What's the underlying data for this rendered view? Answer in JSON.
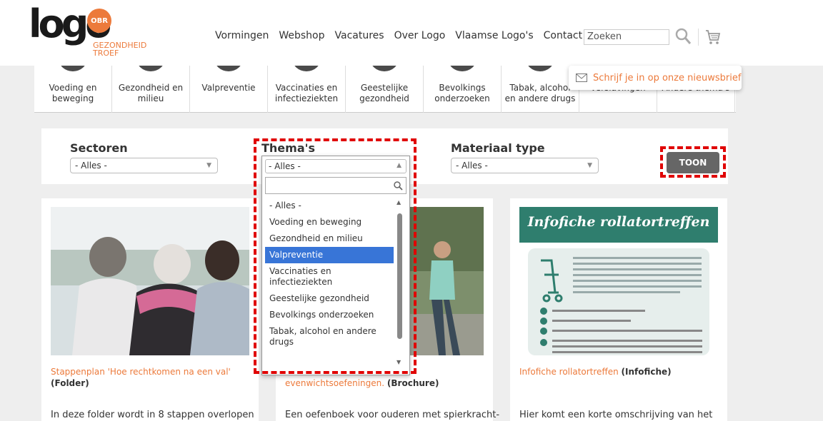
{
  "header": {
    "logo": {
      "word": "logo",
      "badge": "OBR",
      "sub1": "GEZONDHEID",
      "sub2": "TROEF"
    },
    "nav": [
      "Vormingen",
      "Webshop",
      "Vacatures",
      "Over Logo",
      "Vlaamse Logo's",
      "Contact"
    ],
    "search_placeholder": "Zoeken"
  },
  "themes": [
    "Voeding en\nbeweging",
    "Gezondheid en\nmilieu",
    "Valpreventie",
    "Vaccinaties en\ninfectieziekten",
    "Geestelijke\ngezondheid",
    "Bevolkings\nonderzoeken",
    "Tabak, alcohol\nen andere drugs",
    "Verslavingen",
    "Andere thema's"
  ],
  "newsletter": "Schrijf je in op onze nieuwsbrief",
  "filters": {
    "sectoren": {
      "label": "Sectoren",
      "value": "- Alles -"
    },
    "themas": {
      "label": "Thema's",
      "value": "- Alles -"
    },
    "materiaal": {
      "label": "Materiaal type",
      "value": "- Alles -"
    },
    "toon": "TOON"
  },
  "dropdown": {
    "options": [
      "- Alles -",
      "Voeding en beweging",
      "Gezondheid en milieu",
      "Valpreventie",
      "Vaccinaties en infectieziekten",
      "Geestelijke gezondheid",
      "Bevolkings onderzoeken",
      "Tabak, alcohol en andere drugs"
    ],
    "selected": "Valpreventie"
  },
  "cards": [
    {
      "title": "Stappenplan 'Hoe rechtkomen na een val'",
      "kind": "(Folder)",
      "desc": "In deze folder wordt in 8 stappen overlopen"
    },
    {
      "title": "evenwichtsoefeningen.",
      "kind": "(Brochure)",
      "desc": "Een oefenboek voor ouderen met spierkracht-"
    },
    {
      "title": "Infofiche rollatortreffen",
      "kind": "(Infofiche)",
      "desc": "Hier komt een korte omschrijving van het"
    }
  ],
  "infofiche_heading": "Infofiche rollatortreffen",
  "colors": {
    "accent": "#ec7a3b",
    "teal": "#2f7e6e",
    "selected": "#3875d7",
    "highlight": "#e00000"
  }
}
